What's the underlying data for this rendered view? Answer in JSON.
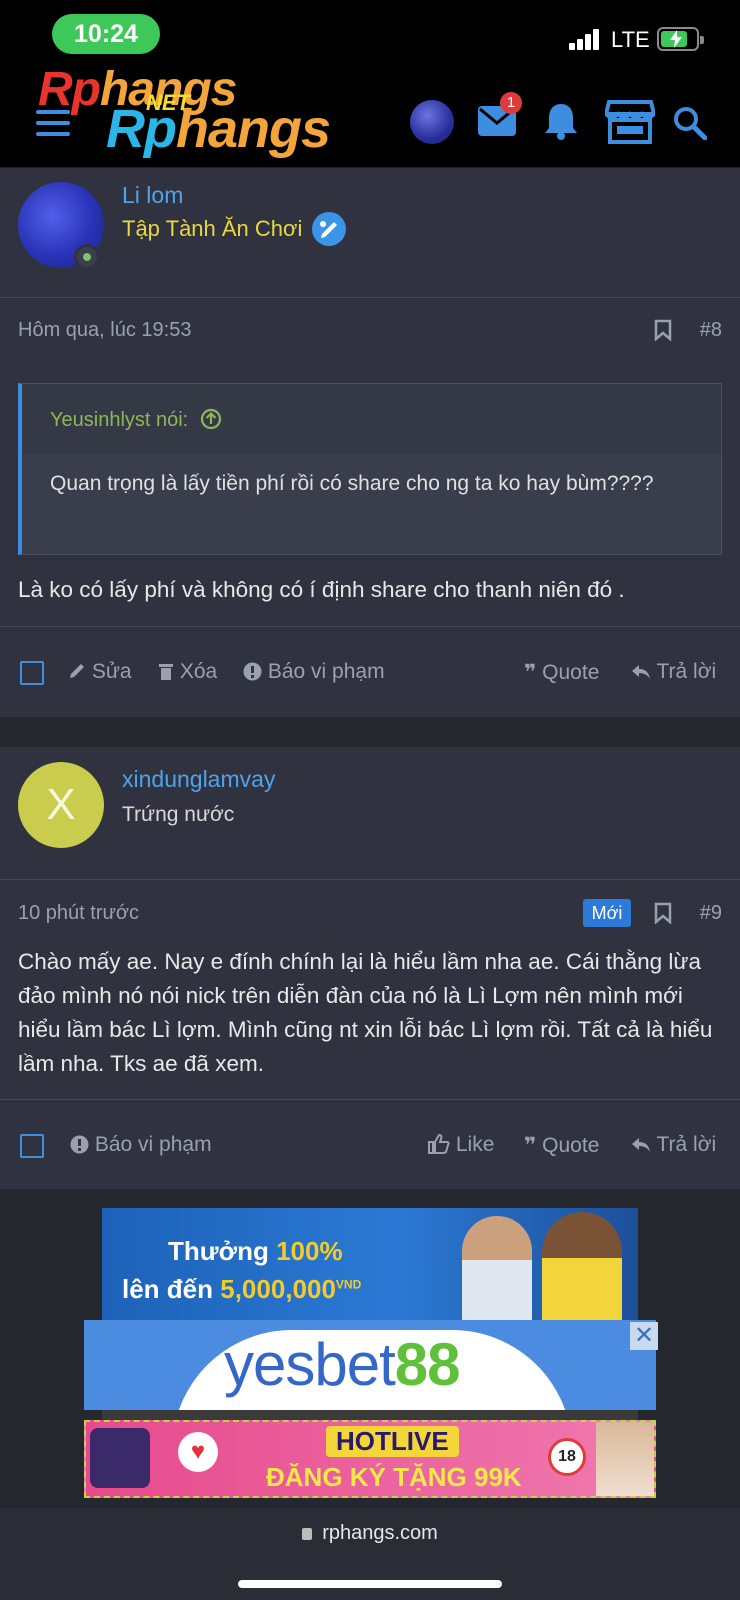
{
  "status_bar": {
    "time": "10:24",
    "network": "LTE"
  },
  "header": {
    "logo_line1_a": "Rp",
    "logo_line1_b": "hangs",
    "logo_line2_a": "Rp",
    "logo_line2_b": "hangs",
    "logo_net": "NET",
    "notification_count": "1"
  },
  "posts": [
    {
      "username": "Li lom",
      "user_title": "Tập Tành Ăn Chơi",
      "timestamp": "Hôm qua, lúc 19:53",
      "post_number": "#8",
      "quote": {
        "author": "Yeusinhlyst nói:",
        "text": "Quan trọng là lấy tiền phí rồi có share cho ng ta ko hay bùm????"
      },
      "body": "Là ko có lấy phí và không có í định share cho thanh niên đó .",
      "actions": {
        "edit": "Sửa",
        "delete": "Xóa",
        "report": "Báo vi phạm",
        "quote": "Quote",
        "reply": "Trả lời"
      }
    },
    {
      "username": "xindunglamvay",
      "avatar_letter": "X",
      "user_title": "Trứng nước",
      "timestamp": "10 phút trước",
      "new_label": "Mới",
      "post_number": "#9",
      "body": "Chào mấy ae. Nay e đính chính lại là hiểu lầm nha ae. Cái thằng lừa đảo mình nó nói nick trên diễn đàn của nó là Lì Lợm nên mình mới hiểu lầm bác Lì lợm. Mình cũng nt xin lỗi bác Lì lợm rồi. Tất cả là hiểu lầm nha. Tks ae đã xem.",
      "actions": {
        "report": "Báo vi phạm",
        "like": "Like",
        "quote": "Quote",
        "reply": "Trả lời"
      }
    }
  ],
  "ads": {
    "promo_line1_a": "Thưởng",
    "promo_line1_b": "100%",
    "promo_line2_a": "lên đến",
    "promo_line2_b": "5,000,000",
    "promo_currency": "VND",
    "yesbet_a": "yesbet",
    "yesbet_b": "88",
    "hotlive_title": "HOTLIVE",
    "hotlive_sub": "ĐĂNG KÝ TẶNG 99K",
    "hotlive_age": "18",
    "close_symbol": "✕"
  },
  "browser": {
    "url": "rphangs.com"
  },
  "colors": {
    "accent": "#3d8de0",
    "username": "#4fa3e8",
    "title_yellow": "#e8d83c",
    "quote_green": "#8fb55a",
    "new_badge": "#2d7bd8"
  }
}
